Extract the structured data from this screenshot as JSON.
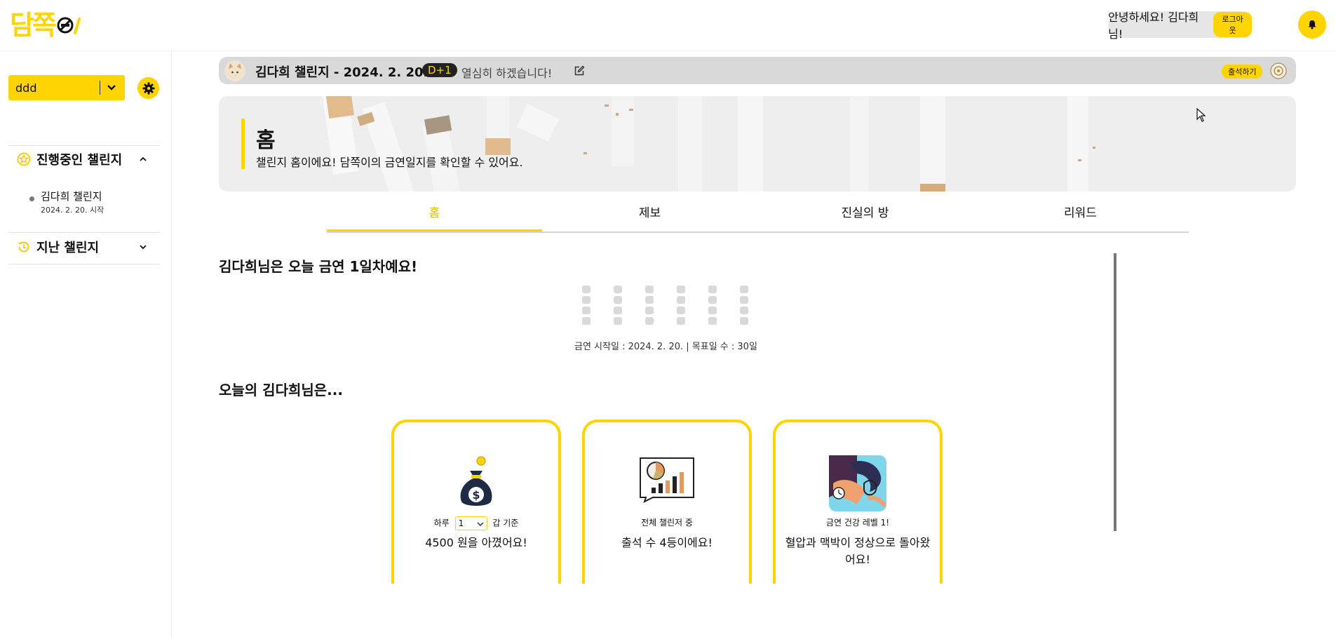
{
  "header": {
    "logo": "담쪽",
    "greeting": "안녕하세요! 김다희 님!",
    "logout_label": "로그아웃",
    "accent_color": "#ffd400"
  },
  "sidebar": {
    "select_value": "ddd",
    "active_section_label": "진행중인 챌린지",
    "active_challenges": [
      {
        "name": "김다희 챌린지",
        "start": "2024. 2. 20. 시작"
      }
    ],
    "past_section_label": "지난 챌린지"
  },
  "challenge_bar": {
    "title": "김다희 챌린지 - 2024. 2. 20.",
    "dday": "D+1",
    "motto": "열심히 하겠습니다!",
    "attend_label": "출석하기"
  },
  "banner": {
    "title": "홈",
    "subtitle": "챌린지 홈이에요! 담쪽이의 금연일지를 확인할 수 있어요."
  },
  "tabs": [
    "홈",
    "제보",
    "진실의 방",
    "리워드"
  ],
  "main": {
    "today_heading": "김다희님은 오늘 금연 1일차예요!",
    "stats_line": "금연 시작일 : 2024. 2. 20. | 목표일 수 : 30일",
    "progress": {
      "days_done": 1,
      "days_goal": 30
    },
    "today_section": "오늘의 김다희님은...",
    "cards": [
      {
        "pre_prefix": "하루",
        "select_value": "1",
        "pre_suffix": "갑 기준",
        "main": "4500 원을 아꼈어요!",
        "icon": "money-bag-icon"
      },
      {
        "pre": "전체 챌린저 중",
        "main": "출석 수 4등이에요!",
        "icon": "chart-icon"
      },
      {
        "pre": "금연 건강 레벨 1!",
        "main": "혈압과 맥박이 정상으로 돌아왔어요!",
        "icon": "blood-pressure-icon"
      }
    ]
  }
}
